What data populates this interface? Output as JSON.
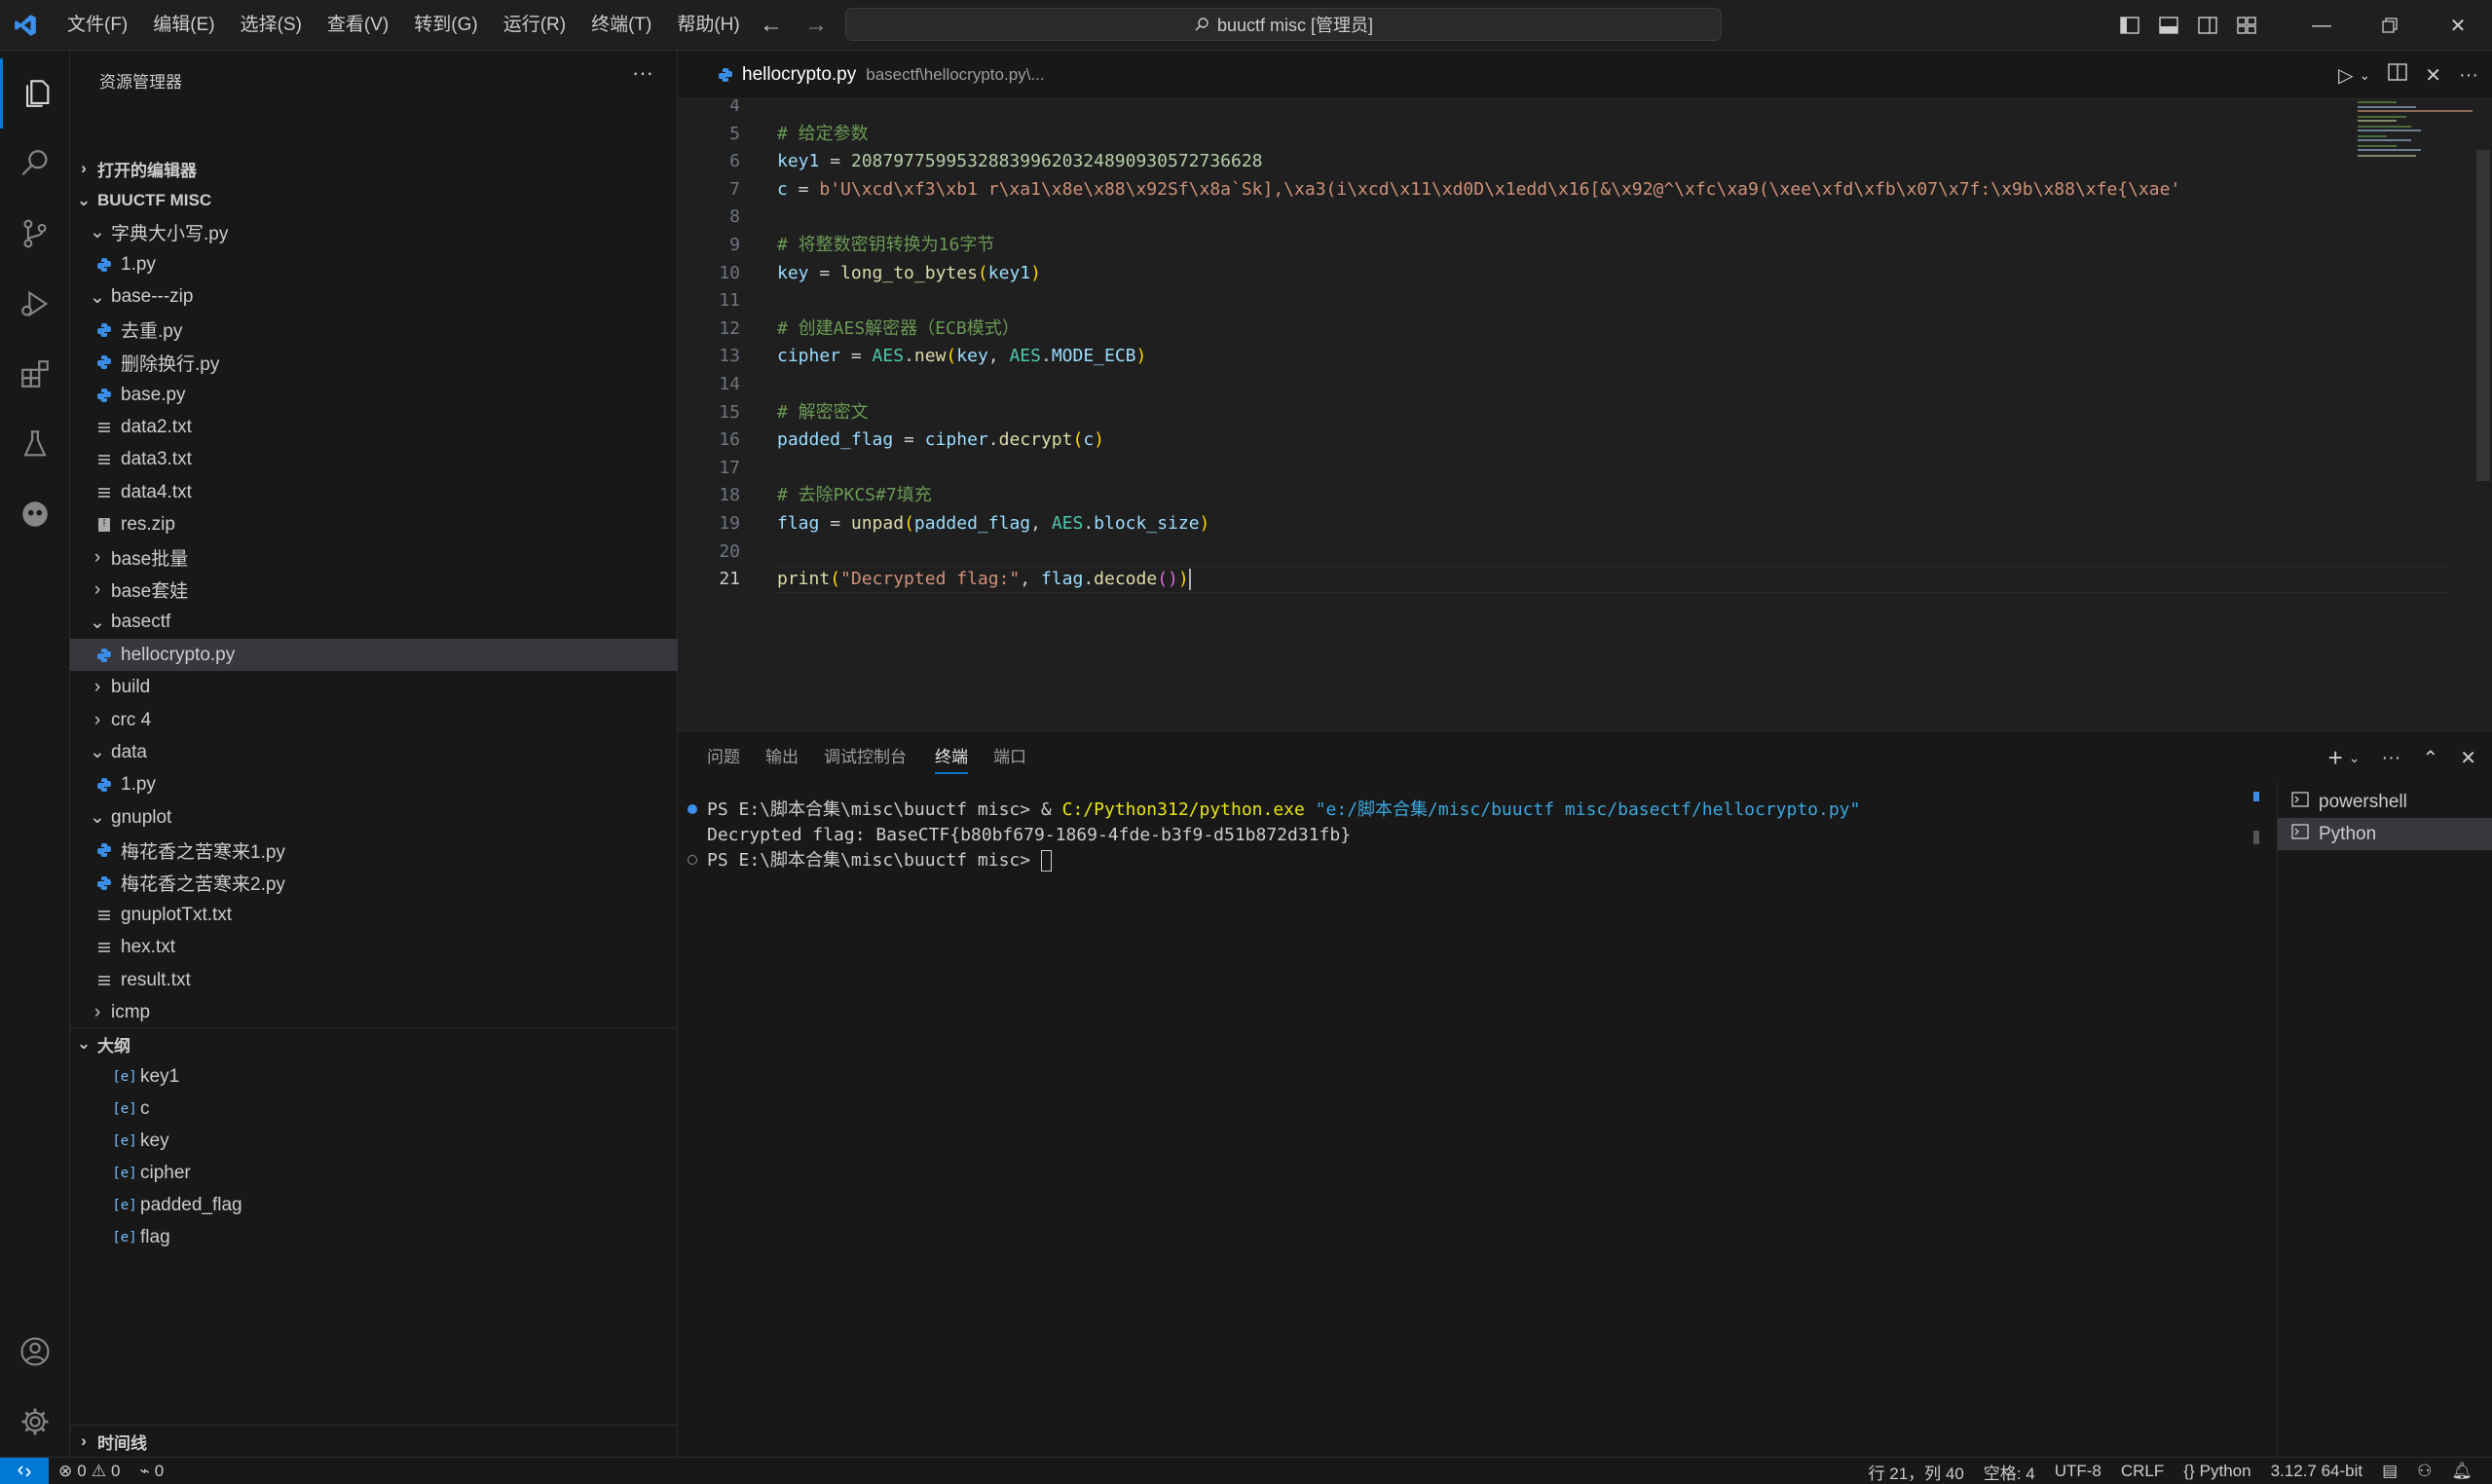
{
  "titlebar": {
    "menus": [
      "文件(F)",
      "编辑(E)",
      "选择(S)",
      "查看(V)",
      "转到(G)",
      "运行(R)",
      "终端(T)",
      "帮助(H)"
    ],
    "search_text": "buuctf misc [管理员]"
  },
  "sidebar": {
    "header": "资源管理器",
    "open_editors": "打开的编辑器",
    "workspace": "BUUCTF MISC",
    "tree": [
      {
        "label": "字典大小写.py",
        "type": "folder-open",
        "depth": 1
      },
      {
        "label": "1.py",
        "type": "py",
        "depth": 2
      },
      {
        "label": "base---zip",
        "type": "folder-open",
        "depth": 1
      },
      {
        "label": "去重.py",
        "type": "py",
        "depth": 2
      },
      {
        "label": "删除换行.py",
        "type": "py",
        "depth": 2
      },
      {
        "label": "base.py",
        "type": "py",
        "depth": 2
      },
      {
        "label": "data2.txt",
        "type": "txt",
        "depth": 2
      },
      {
        "label": "data3.txt",
        "type": "txt",
        "depth": 2
      },
      {
        "label": "data4.txt",
        "type": "txt",
        "depth": 2
      },
      {
        "label": "res.zip",
        "type": "zip",
        "depth": 2
      },
      {
        "label": "base批量",
        "type": "folder",
        "depth": 1
      },
      {
        "label": "base套娃",
        "type": "folder",
        "depth": 1
      },
      {
        "label": "basectf",
        "type": "folder-open",
        "depth": 1
      },
      {
        "label": "hellocrypto.py",
        "type": "py",
        "depth": 2,
        "selected": true
      },
      {
        "label": "build",
        "type": "folder",
        "depth": 1
      },
      {
        "label": "crc 4",
        "type": "folder",
        "depth": 1
      },
      {
        "label": "data",
        "type": "folder-open",
        "depth": 1
      },
      {
        "label": "1.py",
        "type": "py",
        "depth": 2
      },
      {
        "label": "gnuplot",
        "type": "folder-open",
        "depth": 1
      },
      {
        "label": "梅花香之苦寒来1.py",
        "type": "py",
        "depth": 2
      },
      {
        "label": "梅花香之苦寒来2.py",
        "type": "py",
        "depth": 2
      },
      {
        "label": "gnuplotTxt.txt",
        "type": "txt",
        "depth": 2
      },
      {
        "label": "hex.txt",
        "type": "txt",
        "depth": 2
      },
      {
        "label": "result.txt",
        "type": "txt",
        "depth": 2
      },
      {
        "label": "icmp",
        "type": "folder",
        "depth": 1
      }
    ],
    "outline_title": "大纲",
    "outline": [
      "key1",
      "c",
      "key",
      "cipher",
      "padded_flag",
      "flag"
    ],
    "timeline_title": "时间线"
  },
  "editor": {
    "tab_name": "hellocrypto.py",
    "tab_path": "basectf\\hellocrypto.py\\...",
    "lines": [
      {
        "n": "4",
        "tokens": []
      },
      {
        "n": "5",
        "tokens": [
          [
            "c",
            "# 给定参数"
          ]
        ]
      },
      {
        "n": "6",
        "tokens": [
          [
            "v",
            "key1"
          ],
          [
            "p",
            " = "
          ],
          [
            "n",
            "208797759953288399620324890930572736628"
          ]
        ]
      },
      {
        "n": "7",
        "tokens": [
          [
            "v",
            "c"
          ],
          [
            "p",
            " = "
          ],
          [
            "s",
            "b'U\\xcd\\xf3\\xb1 r\\xa1\\x8e\\x88\\x92Sf\\x8a`Sk],\\xa3(i\\xcd\\x11\\xd0D\\x1edd\\x16[&\\x92@^\\xfc\\xa9(\\xee\\xfd\\xfb\\x07\\x7f:\\x9b\\x88\\xfe{\\xae'"
          ]
        ]
      },
      {
        "n": "8",
        "tokens": []
      },
      {
        "n": "9",
        "tokens": [
          [
            "c",
            "# 将整数密钥转换为16字节"
          ]
        ]
      },
      {
        "n": "10",
        "tokens": [
          [
            "v",
            "key"
          ],
          [
            "p",
            " = "
          ],
          [
            "f",
            "long_to_bytes"
          ],
          [
            "b1",
            "("
          ],
          [
            "v",
            "key1"
          ],
          [
            "b1",
            ")"
          ]
        ]
      },
      {
        "n": "11",
        "tokens": []
      },
      {
        "n": "12",
        "tokens": [
          [
            "c",
            "# 创建AES解密器（ECB模式）"
          ]
        ]
      },
      {
        "n": "13",
        "tokens": [
          [
            "v",
            "cipher"
          ],
          [
            "p",
            " = "
          ],
          [
            "cl",
            "AES"
          ],
          [
            "p",
            "."
          ],
          [
            "f",
            "new"
          ],
          [
            "b1",
            "("
          ],
          [
            "v",
            "key"
          ],
          [
            "p",
            ", "
          ],
          [
            "cl",
            "AES"
          ],
          [
            "p",
            "."
          ],
          [
            "v",
            "MODE_ECB"
          ],
          [
            "b1",
            ")"
          ]
        ]
      },
      {
        "n": "14",
        "tokens": []
      },
      {
        "n": "15",
        "tokens": [
          [
            "c",
            "# 解密密文"
          ]
        ]
      },
      {
        "n": "16",
        "tokens": [
          [
            "v",
            "padded_flag"
          ],
          [
            "p",
            " = "
          ],
          [
            "v",
            "cipher"
          ],
          [
            "p",
            "."
          ],
          [
            "f",
            "decrypt"
          ],
          [
            "b1",
            "("
          ],
          [
            "v",
            "c"
          ],
          [
            "b1",
            ")"
          ]
        ]
      },
      {
        "n": "17",
        "tokens": []
      },
      {
        "n": "18",
        "tokens": [
          [
            "c",
            "# 去除PKCS#7填充"
          ]
        ]
      },
      {
        "n": "19",
        "tokens": [
          [
            "v",
            "flag"
          ],
          [
            "p",
            " = "
          ],
          [
            "f",
            "unpad"
          ],
          [
            "b1",
            "("
          ],
          [
            "v",
            "padded_flag"
          ],
          [
            "p",
            ", "
          ],
          [
            "cl",
            "AES"
          ],
          [
            "p",
            "."
          ],
          [
            "v",
            "block_size"
          ],
          [
            "b1",
            ")"
          ]
        ]
      },
      {
        "n": "20",
        "tokens": []
      },
      {
        "n": "21",
        "tokens": [
          [
            "f",
            "print"
          ],
          [
            "b1",
            "("
          ],
          [
            "s",
            "\"Decrypted flag:\""
          ],
          [
            "p",
            ", "
          ],
          [
            "v",
            "flag"
          ],
          [
            "p",
            "."
          ],
          [
            "f",
            "decode"
          ],
          [
            "b2",
            "()"
          ],
          [
            "b1",
            ")"
          ]
        ],
        "current": true
      }
    ]
  },
  "panel": {
    "tabs": [
      "问题",
      "输出",
      "调试控制台",
      "终端",
      "端口"
    ],
    "active_tab": "终端",
    "terminal": {
      "line1_prompt": "PS E:\\脚本合集\\misc\\buuctf misc> & ",
      "line1_exe": "C:/Python312/python.exe",
      "line1_arg": " \"e:/脚本合集/misc/buuctf misc/basectf/hellocrypto.py\"",
      "line2": "Decrypted flag: BaseCTF{b80bf679-1869-4fde-b3f9-d51b872d31fb}",
      "line3_prompt": "PS E:\\脚本合集\\misc\\buuctf misc> "
    },
    "terminals": [
      "powershell",
      "Python"
    ]
  },
  "statusbar": {
    "errors": "0",
    "warnings": "0",
    "ports": "0",
    "position": "行 21，列 40",
    "spaces": "空格: 4",
    "encoding": "UTF-8",
    "eol": "CRLF",
    "language": "Python",
    "interpreter": "3.12.7 64-bit"
  },
  "colors": {
    "accent": "#0078d4",
    "python_icon": "#3b8eea"
  }
}
